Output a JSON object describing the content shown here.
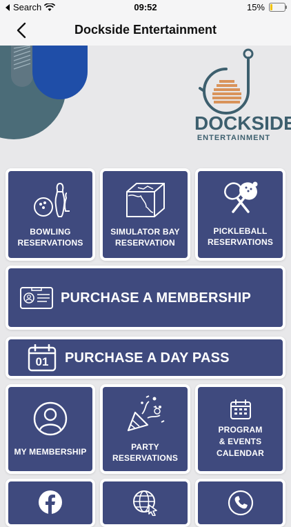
{
  "status": {
    "carrier": "Search",
    "time": "09:52",
    "battery": "15%",
    "battery_level": 0.15
  },
  "nav": {
    "title": "Dockside Entertainment"
  },
  "logo": {
    "line1": "DOCKSIDE",
    "line2": "ENTERTAINMENT"
  },
  "tiles": {
    "bowling": "BOWLING RESERVATIONS",
    "simulator": "SIMULATOR BAY RESERVATION",
    "pickleball": "PICKLEBALL RESERVATIONS",
    "membership": "PURCHASE A MEMBERSHIP",
    "daypass": "PURCHASE A DAY PASS",
    "daypass_date": "01",
    "my_membership": "MY MEMBERSHIP",
    "party": "PARTY RESERVATIONS",
    "calendar": "PROGRAM & EVENTS CALENDAR"
  },
  "icons": [
    "back-chevron-icon",
    "wifi-icon",
    "battery-icon",
    "bowling-icon",
    "simulator-icon",
    "pickleball-icon",
    "id-card-icon",
    "calendar-icon",
    "person-icon",
    "party-popper-icon",
    "facebook-icon",
    "globe-icon",
    "phone-icon"
  ],
  "colors": {
    "tile": "#3f4a7e",
    "accent_blue": "#1f4ea8",
    "teal": "#4b6c78",
    "logo_teal": "#3d5f6e",
    "logo_orange": "#d9935a"
  }
}
